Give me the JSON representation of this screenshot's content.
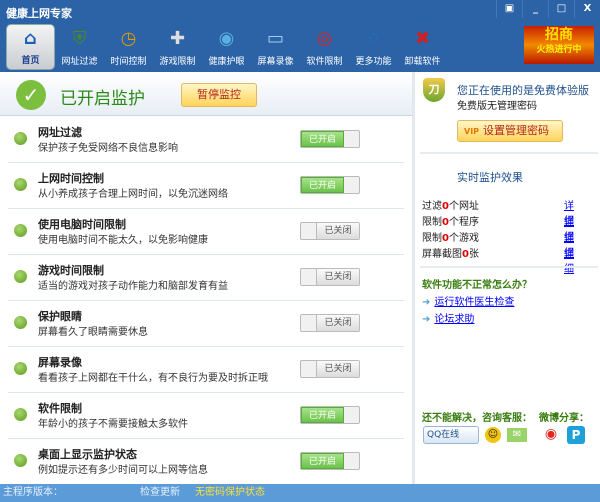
{
  "window": {
    "title": "健康上网专家",
    "controls": [
      "▣",
      "_",
      "□",
      "X"
    ]
  },
  "toolbar": {
    "items": [
      {
        "label": "首页",
        "icon": "home-icon",
        "glyph": "⌂",
        "color": "#1a5fb4"
      },
      {
        "label": "网址过滤",
        "icon": "shield-icon",
        "glyph": "⛨",
        "color": "#4a8a1c"
      },
      {
        "label": "时间控制",
        "icon": "clock-icon",
        "glyph": "◷",
        "color": "#e09a00"
      },
      {
        "label": "游戏限制",
        "icon": "gamepad-icon",
        "glyph": "✚",
        "color": "#ddd"
      },
      {
        "label": "健康护眼",
        "icon": "eye-icon",
        "glyph": "◉",
        "color": "#5ab0e0"
      },
      {
        "label": "屏幕录像",
        "icon": "monitor-icon",
        "glyph": "▭",
        "color": "#9fd0f0"
      },
      {
        "label": "软件限制",
        "icon": "software-disc-icon",
        "glyph": "◎",
        "color": "#e02020"
      },
      {
        "label": "更多功能",
        "icon": "more-icon",
        "glyph": "⁘",
        "color": "#1a6fd0"
      },
      {
        "label": "卸载软件",
        "icon": "uninstall-x-icon",
        "glyph": "✖",
        "color": "#d02020"
      }
    ],
    "ad": {
      "line1": "招商",
      "line2": "火热进行中"
    }
  },
  "status": {
    "text": "已开启监护",
    "pause_button": "暂停监控"
  },
  "features": [
    {
      "title": "网址过滤",
      "desc": "保护孩子免受网络不良信息影响",
      "state": "on",
      "toggle": "已开启"
    },
    {
      "title": "上网时间控制",
      "desc": "从小养成孩子合理上网时间，以免沉迷网络",
      "state": "on",
      "toggle": "已开启"
    },
    {
      "title": "使用电脑时间限制",
      "desc": "使用电脑时间不能太久，以免影响健康",
      "state": "off",
      "toggle": "已关闭"
    },
    {
      "title": "游戏时间限制",
      "desc": "适当的游戏对孩子动作能力和脑部发育有益",
      "state": "off",
      "toggle": "已关闭"
    },
    {
      "title": "保护眼睛",
      "desc": "屏幕看久了眼睛需要休息",
      "state": "off",
      "toggle": "已关闭"
    },
    {
      "title": "屏幕录像",
      "desc": "看看孩子上网都在干什么，有不良行为要及时拆正哦",
      "state": "off",
      "toggle": "已关闭"
    },
    {
      "title": "软件限制",
      "desc": "年龄小的孩子不需要接触太多软件",
      "state": "on",
      "toggle": "已开启"
    },
    {
      "title": "桌面上显示监护状态",
      "desc": "例如提示还有多少时间可以上网等信息",
      "state": "on",
      "toggle": "已开启"
    }
  ],
  "side": {
    "version_title": "您正在使用的是免费体验版",
    "version_sub": "免费版无管理密码",
    "vip": "VIP",
    "set_password": "设置管理密码",
    "effect_title": "实时监护效果",
    "stats": [
      {
        "pre": "过滤",
        "n": "0",
        "post": "个网址",
        "link": "详细"
      },
      {
        "pre": "限制",
        "n": "0",
        "post": "个程序",
        "link": "详细"
      },
      {
        "pre": "限制",
        "n": "0",
        "post": "个游戏",
        "link": "详细"
      },
      {
        "pre": "屏幕截图",
        "n": "0",
        "post": "张",
        "link": "详细"
      }
    ],
    "question": "软件功能不正常怎么办？",
    "link_doctor": "运行软件医生检查",
    "link_forum": "论坛求助",
    "contact": "还不能解决，咨询客服：",
    "share": "微博分享：",
    "qq": "QQ在线"
  },
  "footer": {
    "version": "主程序版本：",
    "check_update": "检查更新",
    "protect": "无密码保护状态"
  },
  "colors": {
    "toolbar": "#2b63a6",
    "footer": "#5a9bd8",
    "on": "#6cc24a",
    "protect": "#ffe033"
  }
}
